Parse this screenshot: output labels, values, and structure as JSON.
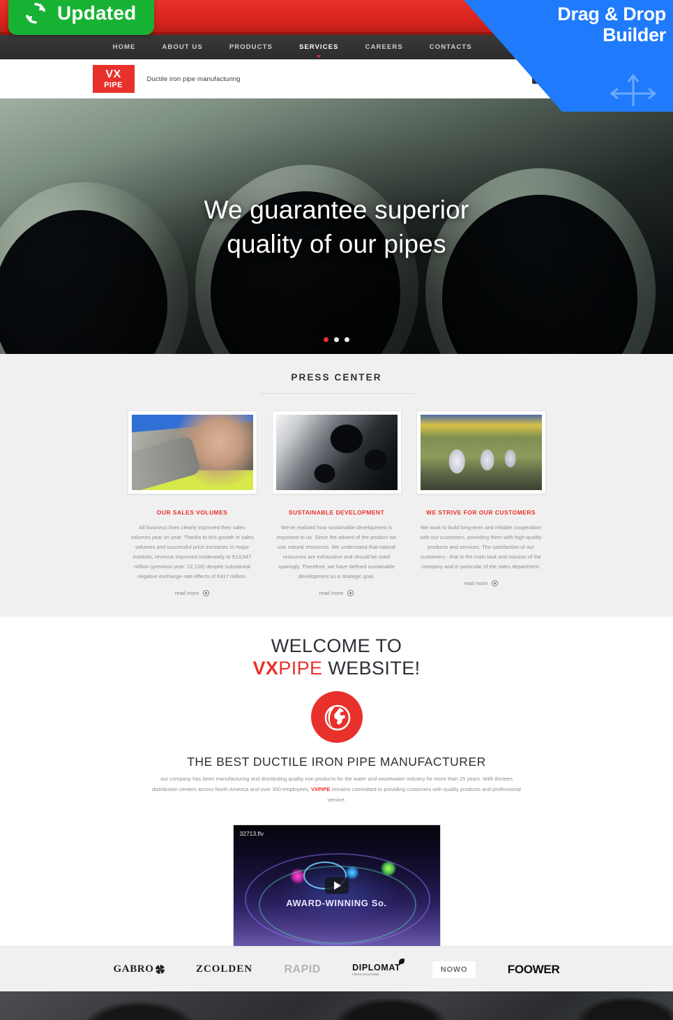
{
  "promo": {
    "updated_badge": "Updated",
    "updated_icon": "refresh-icon",
    "ribbon_line1": "Drag & Drop",
    "ribbon_line2": "Builder",
    "ribbon_color": "#1f7bfc",
    "badge_color": "#17b234"
  },
  "nav": {
    "items": [
      {
        "label": "HOME",
        "active": false
      },
      {
        "label": "ABOUT US",
        "active": false
      },
      {
        "label": "PRODUCTS",
        "active": false
      },
      {
        "label": "SERVICES",
        "active": true
      },
      {
        "label": "CAREERS",
        "active": false
      },
      {
        "label": "CONTACTS",
        "active": false
      }
    ],
    "icons": [
      {
        "name": "location-pin-icon",
        "glyph": "⚑"
      },
      {
        "name": "envelope-icon",
        "glyph": "✉"
      }
    ]
  },
  "header": {
    "logo_top": "VX",
    "logo_bottom": "PIPE",
    "logo_color": "#e8312a",
    "tagline": "Ductile iron pipe manufacturing",
    "social": [
      {
        "name": "facebook-icon",
        "glyph": "f"
      },
      {
        "name": "google-plus-icon",
        "glyph": "g"
      },
      {
        "name": "tumblr-icon",
        "glyph": "t"
      },
      {
        "name": "pinterest-icon",
        "glyph": "p"
      }
    ]
  },
  "hero": {
    "caption_line1": "We guarantee superior",
    "caption_line2": "quality of our pipes",
    "dots": 3,
    "active_dot": 0,
    "active_dot_color": "#e8312a"
  },
  "press": {
    "title": "PRESS CENTER",
    "cards": [
      {
        "image": "worker-with-pipe-photo",
        "heading": "OUR SALES VOLUMES",
        "body": "All business lines clearly improved their sales volumes year on year. Thanks to this growth in sales volumes and successful price increases in major markets, revenue improved moderately to €13,547 million (previous year: 12,128) despite substantial negative exchange rate effects of €417 million.",
        "more_label": "read more"
      },
      {
        "image": "stacked-steel-pipes-photo",
        "heading": "SUSTAINABLE DEVELOPMENT",
        "body": "We've realised how sustainable development is important to us. Since the advent of the product we use natural resources. We understand that natural resources are exhaustive and should be used sparingly. Therefore, we have defined sustainable development as a strategic goal.",
        "more_label": "read more"
      },
      {
        "image": "steel-coil-factory-photo",
        "heading": "WE STRIVE FOR OUR CUSTOMERS",
        "body": "We work to build long-term and reliable cooperation with our customers, providing them with high-quality products and services. The satisfaction of our customers - that is the main task and mission of the company and in particular of the sales department.",
        "more_label": "read more"
      }
    ]
  },
  "welcome": {
    "line1": "WELCOME TO",
    "brand_vx": "VX",
    "brand_pipe": "PIPE",
    "line2_tail": " WEBSITE!",
    "logo_icon": "globe-flame-icon",
    "subtitle": "THE BEST DUCTILE IRON PIPE MANUFACTURER",
    "paragraph_a": "our company has been manufacturing and distributing quality iron products for the water and wastewater industry for more than 25 years. With thirteen distribution centers across North America and over 300 employees, ",
    "paragraph_brand": "VXPIPE",
    "paragraph_b": " remains committed to providing customers with quality products and professional service."
  },
  "video": {
    "filename": "32713.flv",
    "overlay_title": "AWARD-WINNING So.",
    "play_button": "play-icon"
  },
  "brands": [
    {
      "name": "GABRO",
      "style": "serif-swirl"
    },
    {
      "name": "ZCOLDEN",
      "style": "serif"
    },
    {
      "name": "RAPID",
      "style": "grey-condensed"
    },
    {
      "name": "DIPLOMAT",
      "sub": "FRESH SOLUTIONS",
      "style": "bold-leaf"
    },
    {
      "name": "NOWO",
      "style": "boxed"
    },
    {
      "name": "FOOWER",
      "style": "heavy"
    }
  ]
}
